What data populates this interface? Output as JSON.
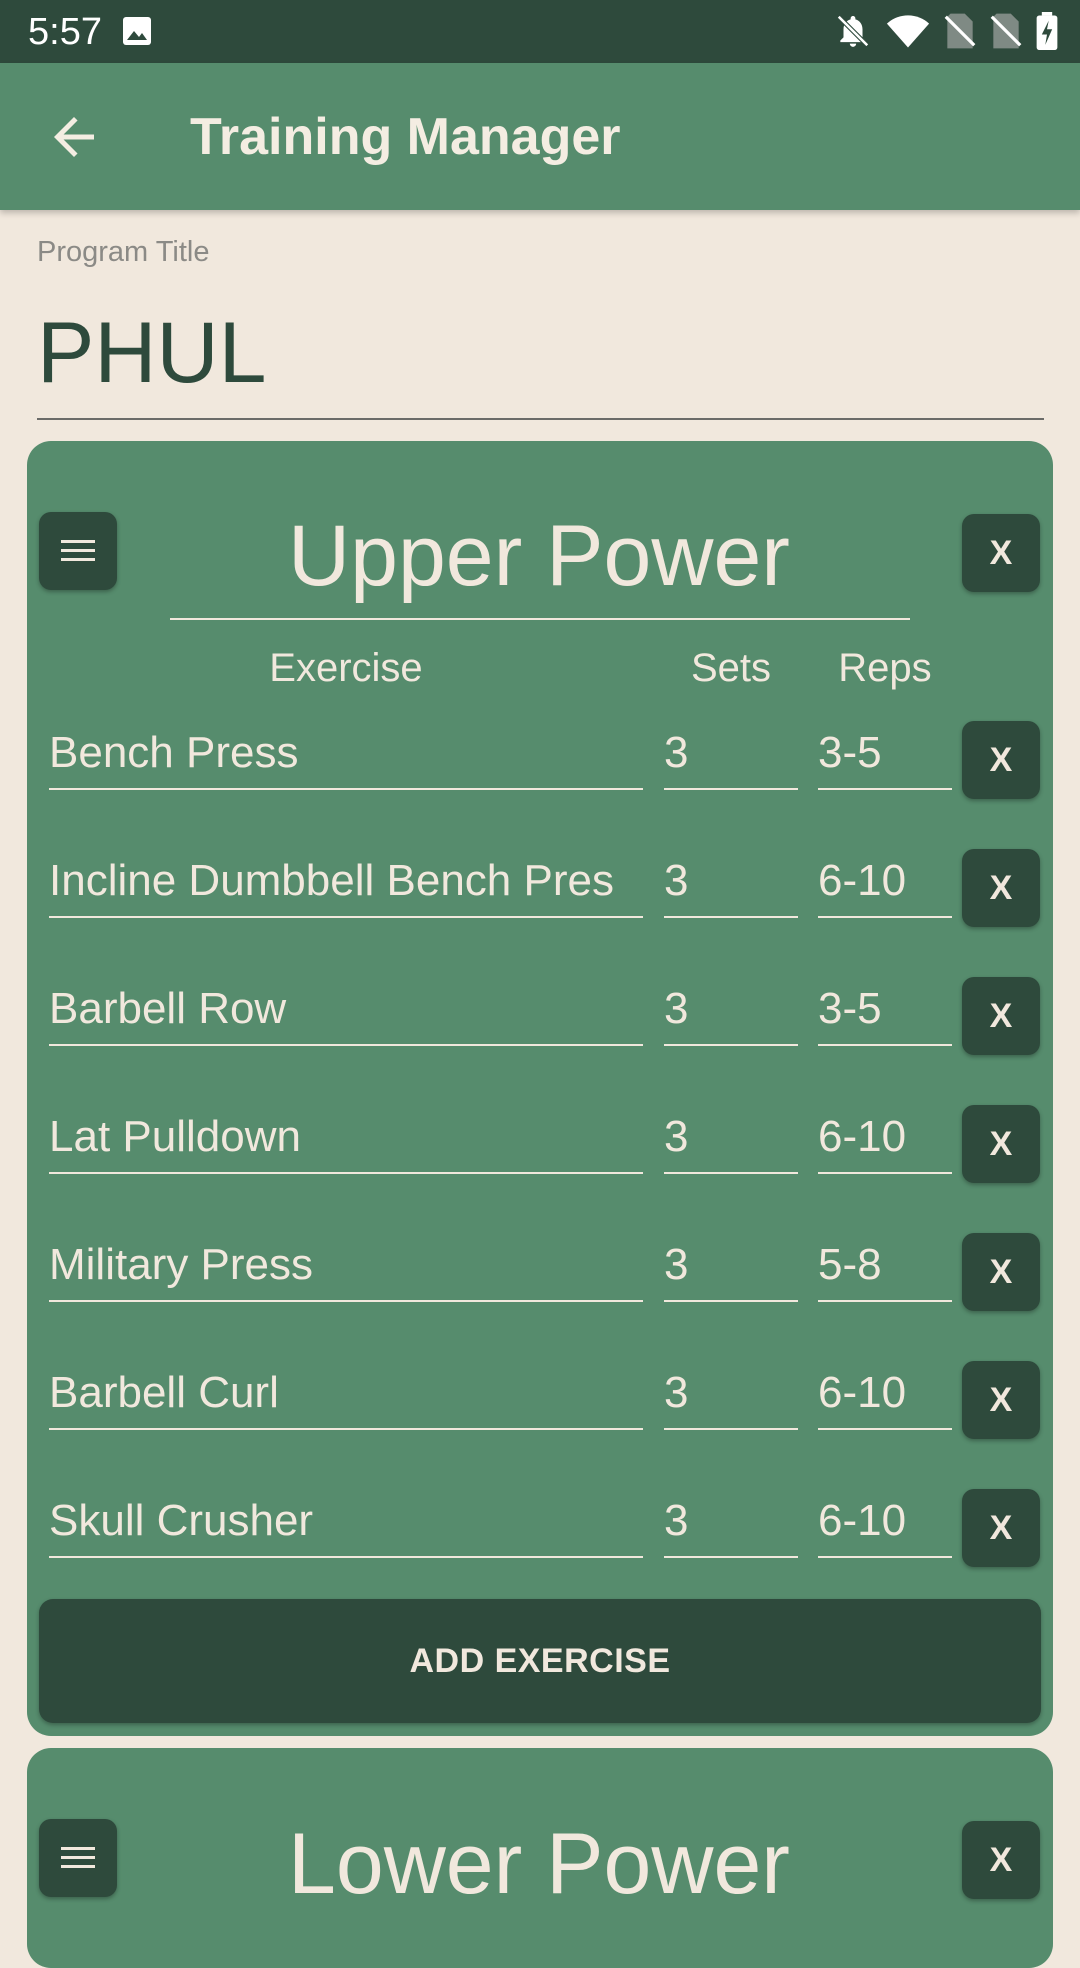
{
  "status_bar": {
    "time": "5:57"
  },
  "app_bar": {
    "title": "Training Manager"
  },
  "program": {
    "label": "Program Title",
    "title": "PHUL"
  },
  "columns": {
    "exercise": "Exercise",
    "sets": "Sets",
    "reps": "Reps"
  },
  "days": [
    {
      "title": "Upper Power",
      "remove_label": "X",
      "exercises": [
        {
          "name": "Bench Press",
          "sets": "3",
          "reps": "3-5",
          "remove_label": "X"
        },
        {
          "name": "Incline Dumbbell Bench Pres",
          "sets": "3",
          "reps": "6-10",
          "remove_label": "X"
        },
        {
          "name": "Barbell Row",
          "sets": "3",
          "reps": "3-5",
          "remove_label": "X"
        },
        {
          "name": "Lat Pulldown",
          "sets": "3",
          "reps": "6-10",
          "remove_label": "X"
        },
        {
          "name": "Military Press",
          "sets": "3",
          "reps": "5-8",
          "remove_label": "X"
        },
        {
          "name": "Barbell Curl",
          "sets": "3",
          "reps": "6-10",
          "remove_label": "X"
        },
        {
          "name": "Skull Crusher",
          "sets": "3",
          "reps": "6-10",
          "remove_label": "X"
        }
      ],
      "add_label": "ADD EXERCISE"
    },
    {
      "title": "Lower Power",
      "remove_label": "X"
    }
  ],
  "icons": {
    "status": [
      "gallery-icon",
      "notifications-off-icon",
      "wifi-icon",
      "no-sim-icon",
      "no-sim-icon",
      "battery-charging-icon"
    ],
    "back": "back-arrow-icon",
    "drag": "drag-handle-icon"
  },
  "colors": {
    "status_bar": "#2e4a3c",
    "app_bar": "#568c6d",
    "background": "#f1e8dd",
    "card": "#568c6d",
    "button": "#2e4a3c",
    "text_light": "#f1e8dd"
  }
}
